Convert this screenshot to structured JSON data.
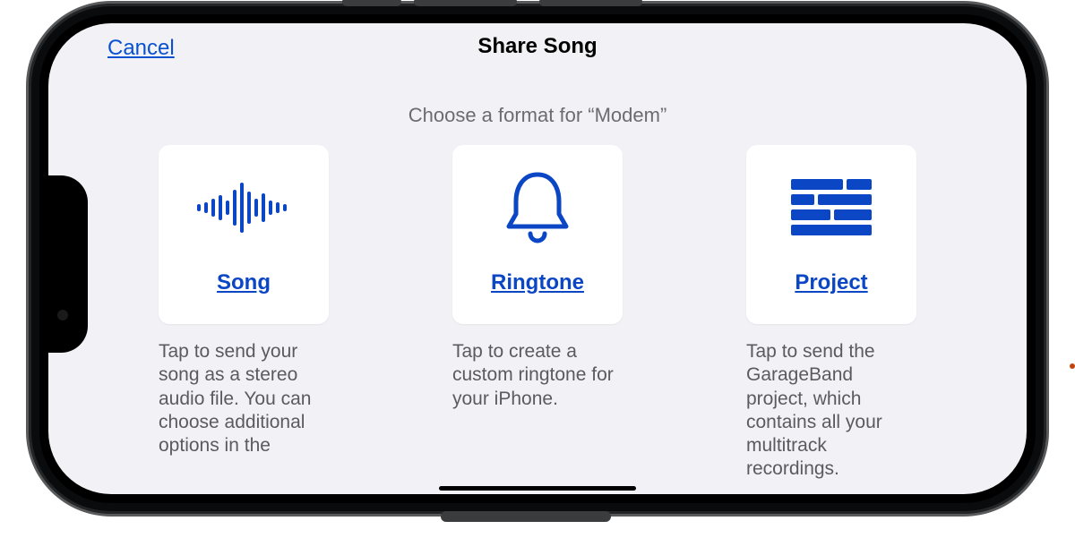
{
  "header": {
    "cancel": "Cancel",
    "title": "Share Song"
  },
  "subtitle": "Choose a format for “Modem”",
  "options": [
    {
      "label": "Song",
      "description": "Tap to send your song as a stereo audio file. You can choose additional options in the"
    },
    {
      "label": "Ringtone",
      "description": "Tap to create a custom ringtone for your iPhone."
    },
    {
      "label": "Project",
      "description": "Tap to send the GarageBand project, which contains all your multitrack recordings."
    }
  ]
}
